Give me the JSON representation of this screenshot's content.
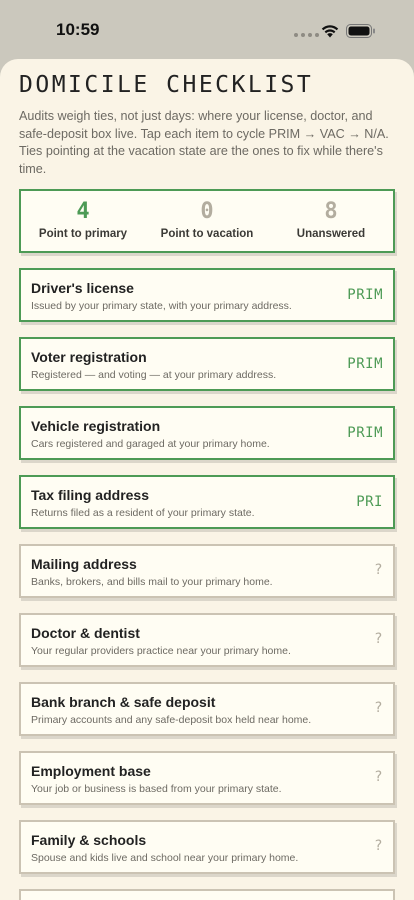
{
  "status_bar": {
    "time": "10:59",
    "icons": [
      "signal-dots-icon",
      "wifi-icon",
      "battery-icon"
    ]
  },
  "header": {
    "title": "DOMICILE CHECKLIST",
    "intro": "Audits weigh ties, not just days: where your license, doctor, and safe-deposit box live. Tap each item to cycle PRIM → VAC → N/A. Ties pointing at the vacation state are the ones to fix while there's time."
  },
  "summary": {
    "stats": [
      {
        "value": "4",
        "label": "Point to primary",
        "color": "#4d9a55"
      },
      {
        "value": "0",
        "label": "Point to vacation",
        "color": "#b3ad9f"
      },
      {
        "value": "8",
        "label": "Unanswered",
        "color": "#b3ad9f"
      }
    ]
  },
  "checklist": {
    "items": [
      {
        "title": "Driver's license",
        "description": "Issued by your primary state, with your primary address.",
        "status": "PRIM"
      },
      {
        "title": "Voter registration",
        "description": "Registered — and voting — at your primary address.",
        "status": "PRIM"
      },
      {
        "title": "Vehicle registration",
        "description": "Cars registered and garaged at your primary home.",
        "status": "PRIM"
      },
      {
        "title": "Tax filing address",
        "description": "Returns filed as a resident of your primary state.",
        "status": "PRI"
      },
      {
        "title": "Mailing address",
        "description": "Banks, brokers, and bills mail to your primary home.",
        "status": "?"
      },
      {
        "title": "Doctor & dentist",
        "description": "Your regular providers practice near your primary home.",
        "status": "?"
      },
      {
        "title": "Bank branch & safe deposit",
        "description": "Primary accounts and any safe-deposit box held near home.",
        "status": "?"
      },
      {
        "title": "Employment base",
        "description": "Your job or business is based from your primary state.",
        "status": "?"
      },
      {
        "title": "Family & schools",
        "description": "Spouse and kids live and school near your primary home.",
        "status": "?"
      },
      {
        "title": "",
        "description": "",
        "status": ""
      }
    ]
  },
  "colors": {
    "primary_green": "#4d9a55",
    "unanswered_gray": "#b3ad9f",
    "sheet_background": "#faf4e6"
  }
}
